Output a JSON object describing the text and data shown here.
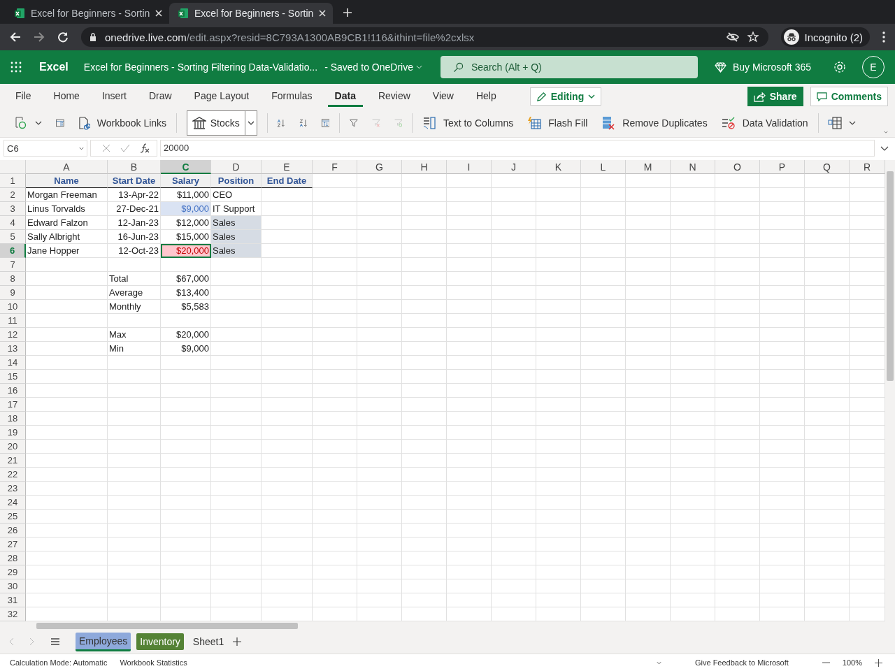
{
  "browser": {
    "tabs": [
      {
        "title": "Excel for Beginners - Sortin",
        "selected": false
      },
      {
        "title": "Excel for Beginners - Sortin",
        "selected": true
      }
    ],
    "url": {
      "host": "onedrive.live.com",
      "path": "/edit.aspx?resid=8C793A1300AB9CB1!116&ithint=file%2cxlsx"
    },
    "profile": "Incognito (2)"
  },
  "app": {
    "name": "Excel",
    "document": "Excel for Beginners - Sorting Filtering Data-Validatio...",
    "saved": "- Saved to OneDrive",
    "search_placeholder": "Search (Alt + Q)",
    "buy": "Buy Microsoft 365",
    "avatar": "E"
  },
  "ribbon": {
    "tabs": [
      {
        "label": "File",
        "selected": false
      },
      {
        "label": "Home",
        "selected": false
      },
      {
        "label": "Insert",
        "selected": false
      },
      {
        "label": "Draw",
        "selected": false
      },
      {
        "label": "Page Layout",
        "selected": false
      },
      {
        "label": "Formulas",
        "selected": false
      },
      {
        "label": "Data",
        "selected": true
      },
      {
        "label": "Review",
        "selected": false
      },
      {
        "label": "View",
        "selected": false
      },
      {
        "label": "Help",
        "selected": false
      }
    ],
    "mode": "Editing",
    "share": "Share",
    "comments": "Comments",
    "toolbar": {
      "workbook_links": "Workbook Links",
      "stocks": "Stocks",
      "text_to_columns": "Text to Columns",
      "flash_fill": "Flash Fill",
      "remove_duplicates": "Remove Duplicates",
      "data_validation": "Data Validation"
    }
  },
  "formula_bar": {
    "name_box": "C6",
    "value": "20000"
  },
  "sheet": {
    "columns": [
      {
        "label": "A",
        "selected": false
      },
      {
        "label": "B",
        "selected": false
      },
      {
        "label": "C",
        "selected": true
      },
      {
        "label": "D",
        "selected": false
      },
      {
        "label": "E",
        "selected": false
      },
      {
        "label": "F",
        "selected": false
      },
      {
        "label": "G",
        "selected": false
      },
      {
        "label": "H",
        "selected": false
      },
      {
        "label": "I",
        "selected": false
      },
      {
        "label": "J",
        "selected": false
      },
      {
        "label": "K",
        "selected": false
      },
      {
        "label": "L",
        "selected": false
      },
      {
        "label": "M",
        "selected": false
      },
      {
        "label": "N",
        "selected": false
      },
      {
        "label": "O",
        "selected": false
      },
      {
        "label": "P",
        "selected": false
      },
      {
        "label": "Q",
        "selected": false
      },
      {
        "label": "R",
        "selected": false
      }
    ],
    "rows": [
      {
        "label": "1",
        "selected": false,
        "cells": [
          {
            "text": "Name",
            "kind": "header",
            "selected": false
          },
          {
            "text": "Start Date",
            "kind": "header",
            "selected": false
          },
          {
            "text": "Salary",
            "kind": "header",
            "selected": false
          },
          {
            "text": "Position",
            "kind": "header",
            "selected": false
          },
          {
            "text": "End Date",
            "kind": "header",
            "selected": false
          }
        ]
      },
      {
        "label": "2",
        "selected": false,
        "cells": [
          {
            "text": "Morgan Freeman",
            "kind": "text",
            "selected": false
          },
          {
            "text": "13-Apr-22",
            "kind": "number",
            "selected": false
          },
          {
            "text": "$11,000",
            "kind": "number",
            "selected": false
          },
          {
            "text": "CEO",
            "kind": "text",
            "selected": false
          }
        ]
      },
      {
        "label": "3",
        "selected": false,
        "cells": [
          {
            "text": "Linus Torvalds",
            "kind": "text",
            "selected": false
          },
          {
            "text": "27-Dec-21",
            "kind": "number",
            "selected": false
          },
          {
            "text": "$9,000",
            "kind": "accent",
            "color": "#dae3f3",
            "selected": false
          },
          {
            "text": "IT Support",
            "kind": "text",
            "selected": false
          }
        ]
      },
      {
        "label": "4",
        "selected": false,
        "cells": [
          {
            "text": "Edward Falzon",
            "kind": "text",
            "selected": false
          },
          {
            "text": "12-Jan-23",
            "kind": "number",
            "selected": false
          },
          {
            "text": "$12,000",
            "kind": "number",
            "selected": false
          },
          {
            "text": "Sales",
            "kind": "text",
            "color": "#d6dce4",
            "selected": false
          }
        ]
      },
      {
        "label": "5",
        "selected": false,
        "cells": [
          {
            "text": "Sally Albright",
            "kind": "text",
            "selected": false
          },
          {
            "text": "16-Jun-23",
            "kind": "number",
            "selected": false
          },
          {
            "text": "$15,000",
            "kind": "number",
            "selected": false
          },
          {
            "text": "Sales",
            "kind": "text",
            "color": "#d6dce4",
            "selected": false
          }
        ]
      },
      {
        "label": "6",
        "selected": true,
        "cells": [
          {
            "text": "Jane Hopper",
            "kind": "text",
            "selected": false
          },
          {
            "text": "12-Oct-23",
            "kind": "number",
            "selected": false
          },
          {
            "text": "$20,000",
            "kind": "alert",
            "color": "#ffc7ce",
            "selected": true
          },
          {
            "text": "Sales",
            "kind": "text",
            "color": "#d6dce4",
            "selected": false
          }
        ]
      },
      {
        "label": "7",
        "selected": false,
        "cells": []
      },
      {
        "label": "8",
        "selected": false,
        "cells": [
          null,
          {
            "text": "Total",
            "kind": "text",
            "selected": false
          },
          {
            "text": "$67,000",
            "kind": "number",
            "selected": false
          }
        ]
      },
      {
        "label": "9",
        "selected": false,
        "cells": [
          null,
          {
            "text": "Average",
            "kind": "text",
            "selected": false
          },
          {
            "text": "$13,400",
            "kind": "number",
            "selected": false
          }
        ]
      },
      {
        "label": "10",
        "selected": false,
        "cells": [
          null,
          {
            "text": "Monthly",
            "kind": "text",
            "selected": false
          },
          {
            "text": "$5,583",
            "kind": "number",
            "selected": false
          }
        ]
      },
      {
        "label": "11",
        "selected": false,
        "cells": []
      },
      {
        "label": "12",
        "selected": false,
        "cells": [
          null,
          {
            "text": "Max",
            "kind": "text",
            "selected": false
          },
          {
            "text": "$20,000",
            "kind": "number",
            "selected": false
          }
        ]
      },
      {
        "label": "13",
        "selected": false,
        "cells": [
          null,
          {
            "text": "Min",
            "kind": "text",
            "selected": false
          },
          {
            "text": "$9,000",
            "kind": "number",
            "selected": false
          }
        ]
      },
      {
        "label": "14",
        "selected": false,
        "cells": []
      },
      {
        "label": "15",
        "selected": false,
        "cells": []
      },
      {
        "label": "16",
        "selected": false,
        "cells": []
      },
      {
        "label": "17",
        "selected": false,
        "cells": []
      },
      {
        "label": "18",
        "selected": false,
        "cells": []
      },
      {
        "label": "19",
        "selected": false,
        "cells": []
      },
      {
        "label": "20",
        "selected": false,
        "cells": []
      },
      {
        "label": "21",
        "selected": false,
        "cells": []
      },
      {
        "label": "22",
        "selected": false,
        "cells": []
      },
      {
        "label": "23",
        "selected": false,
        "cells": []
      },
      {
        "label": "24",
        "selected": false,
        "cells": []
      },
      {
        "label": "25",
        "selected": false,
        "cells": []
      },
      {
        "label": "26",
        "selected": false,
        "cells": []
      },
      {
        "label": "27",
        "selected": false,
        "cells": []
      },
      {
        "label": "28",
        "selected": false,
        "cells": []
      },
      {
        "label": "29",
        "selected": false,
        "cells": []
      },
      {
        "label": "30",
        "selected": false,
        "cells": []
      },
      {
        "label": "31",
        "selected": false,
        "cells": []
      },
      {
        "label": "32",
        "selected": false,
        "cells": []
      }
    ]
  },
  "sheet_tabs": [
    {
      "label": "Employees",
      "selected": true,
      "color": "#8ea9db"
    },
    {
      "label": "Inventory",
      "selected": false,
      "color": "#548235"
    },
    {
      "label": "Sheet1",
      "selected": false
    }
  ],
  "status_bar": {
    "calculation": "Calculation Mode: Automatic",
    "statistics": "Workbook Statistics",
    "feedback": "Give Feedback to Microsoft",
    "zoom": "100%"
  }
}
